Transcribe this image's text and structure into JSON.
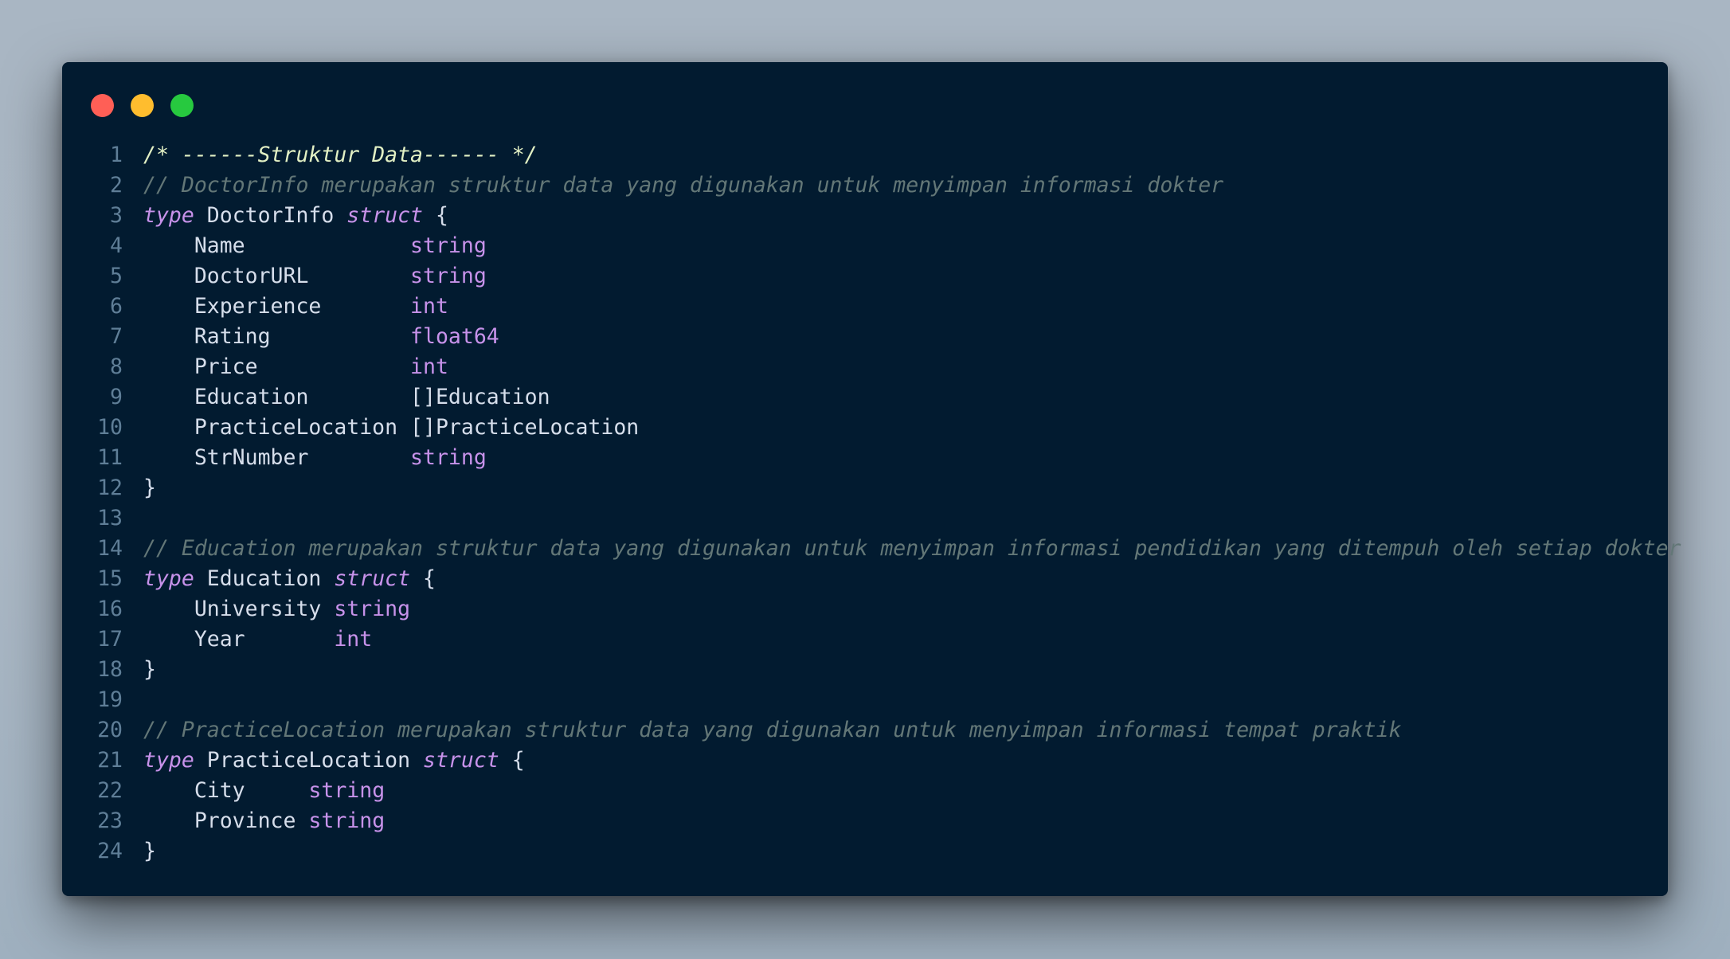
{
  "window": {
    "controls": {
      "close_color": "#ff5f56",
      "minimize_color": "#ffbd2e",
      "maximize_color": "#27c93f"
    }
  },
  "code": {
    "lines": [
      {
        "n": "1",
        "segments": [
          {
            "t": "/* ------",
            "c": "cm-bold"
          },
          {
            "t": "Struktur Data",
            "c": "cm-bold"
          },
          {
            "t": "------ */",
            "c": "cm-bold"
          }
        ]
      },
      {
        "n": "2",
        "segments": [
          {
            "t": "// DoctorInfo merupakan struktur data yang digunakan untuk menyimpan informasi dokter",
            "c": "cm"
          }
        ]
      },
      {
        "n": "3",
        "segments": [
          {
            "t": "type",
            "c": "kw"
          },
          {
            "t": " DoctorInfo ",
            "c": "pl"
          },
          {
            "t": "struct",
            "c": "kw"
          },
          {
            "t": " {",
            "c": "pl"
          }
        ]
      },
      {
        "n": "4",
        "segments": [
          {
            "t": "    Name             ",
            "c": "pl"
          },
          {
            "t": "string",
            "c": "ty"
          }
        ]
      },
      {
        "n": "5",
        "segments": [
          {
            "t": "    DoctorURL        ",
            "c": "pl"
          },
          {
            "t": "string",
            "c": "ty"
          }
        ]
      },
      {
        "n": "6",
        "segments": [
          {
            "t": "    Experience       ",
            "c": "pl"
          },
          {
            "t": "int",
            "c": "ty"
          }
        ]
      },
      {
        "n": "7",
        "segments": [
          {
            "t": "    Rating           ",
            "c": "pl"
          },
          {
            "t": "float64",
            "c": "ty"
          }
        ]
      },
      {
        "n": "8",
        "segments": [
          {
            "t": "    Price            ",
            "c": "pl"
          },
          {
            "t": "int",
            "c": "ty"
          }
        ]
      },
      {
        "n": "9",
        "segments": [
          {
            "t": "    Education        ",
            "c": "pl"
          },
          {
            "t": "[]Education",
            "c": "pl"
          }
        ]
      },
      {
        "n": "10",
        "segments": [
          {
            "t": "    PracticeLocation ",
            "c": "pl"
          },
          {
            "t": "[]PracticeLocation",
            "c": "pl"
          }
        ]
      },
      {
        "n": "11",
        "segments": [
          {
            "t": "    StrNumber        ",
            "c": "pl"
          },
          {
            "t": "string",
            "c": "ty"
          }
        ]
      },
      {
        "n": "12",
        "segments": [
          {
            "t": "}",
            "c": "pl"
          }
        ]
      },
      {
        "n": "13",
        "segments": []
      },
      {
        "n": "14",
        "segments": [
          {
            "t": "// Education merupakan struktur data yang digunakan untuk menyimpan informasi pendidikan yang ditempuh oleh setiap dokter",
            "c": "cm"
          }
        ]
      },
      {
        "n": "15",
        "segments": [
          {
            "t": "type",
            "c": "kw"
          },
          {
            "t": " Education ",
            "c": "pl"
          },
          {
            "t": "struct",
            "c": "kw"
          },
          {
            "t": " {",
            "c": "pl"
          }
        ]
      },
      {
        "n": "16",
        "segments": [
          {
            "t": "    University ",
            "c": "pl"
          },
          {
            "t": "string",
            "c": "ty"
          }
        ]
      },
      {
        "n": "17",
        "segments": [
          {
            "t": "    Year       ",
            "c": "pl"
          },
          {
            "t": "int",
            "c": "ty"
          }
        ]
      },
      {
        "n": "18",
        "segments": [
          {
            "t": "}",
            "c": "pl"
          }
        ]
      },
      {
        "n": "19",
        "segments": []
      },
      {
        "n": "20",
        "segments": [
          {
            "t": "// PracticeLocation merupakan struktur data yang digunakan untuk menyimpan informasi tempat praktik",
            "c": "cm"
          }
        ]
      },
      {
        "n": "21",
        "segments": [
          {
            "t": "type",
            "c": "kw"
          },
          {
            "t": " PracticeLocation ",
            "c": "pl"
          },
          {
            "t": "struct",
            "c": "kw"
          },
          {
            "t": " {",
            "c": "pl"
          }
        ]
      },
      {
        "n": "22",
        "segments": [
          {
            "t": "    City     ",
            "c": "pl"
          },
          {
            "t": "string",
            "c": "ty"
          }
        ]
      },
      {
        "n": "23",
        "segments": [
          {
            "t": "    Province ",
            "c": "pl"
          },
          {
            "t": "string",
            "c": "ty"
          }
        ]
      },
      {
        "n": "24",
        "segments": [
          {
            "t": "}",
            "c": "pl"
          }
        ]
      }
    ]
  }
}
